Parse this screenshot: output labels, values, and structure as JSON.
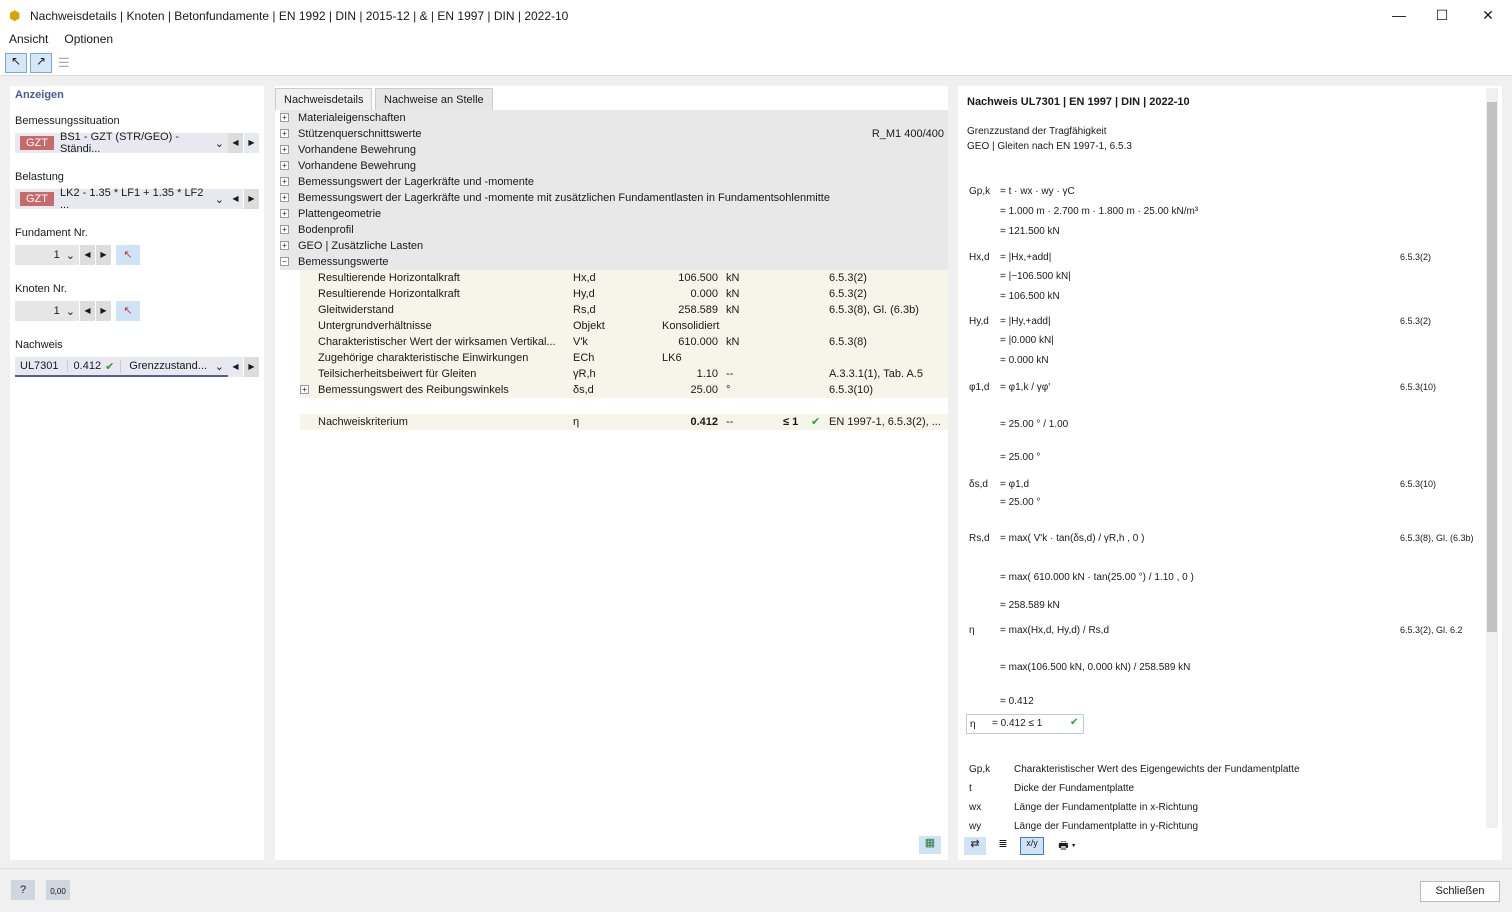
{
  "window": {
    "title": "Nachweisdetails | Knoten | Betonfundamente | EN 1992 | DIN | 2015-12 | & | EN 1997 | DIN | 2022-10"
  },
  "menu": [
    "Ansicht",
    "Optionen"
  ],
  "left": {
    "header": "Anzeigen",
    "design_situation": {
      "label": "Bemessungssituation",
      "badge": "GZT",
      "value": "BS1 - GZT (STR/GEO) - Ständi..."
    },
    "loading": {
      "label": "Belastung",
      "badge": "GZT",
      "value": "LK2 - 1.35 * LF1 + 1.35 * LF2 ..."
    },
    "foundation": {
      "label": "Fundament Nr.",
      "value": "1"
    },
    "node": {
      "label": "Knoten Nr.",
      "value": "1"
    },
    "check": {
      "label": "Nachweis",
      "id": "UL7301",
      "ratio": "0.412",
      "type": "Grenzzustand..."
    }
  },
  "tabs": [
    "Nachweisdetails",
    "Nachweise an Stelle"
  ],
  "tree": [
    {
      "label": "Materialeigenschaften"
    },
    {
      "label": "Stützenquerschnittswerte",
      "value": "R_M1 400/400"
    },
    {
      "label": "Vorhandene Bewehrung"
    },
    {
      "label": "Vorhandene Bewehrung"
    },
    {
      "label": "Bemessungswert der Lagerkräfte und -momente"
    },
    {
      "label": "Bemessungswert der Lagerkräfte und -momente mit zusätzlichen Fundamentlasten in Fundamentsohlenmitte"
    },
    {
      "label": "Plattengeometrie"
    },
    {
      "label": "Bodenprofil"
    },
    {
      "label": "GEO | Zusätzliche Lasten"
    },
    {
      "label": "Bemessungswerte"
    }
  ],
  "rows": [
    {
      "desc": "Resultierende Horizontalkraft",
      "sym": "Hx,d",
      "val": "106.500",
      "unit": "kN",
      "ref": "6.5.3(2)"
    },
    {
      "desc": "Resultierende Horizontalkraft",
      "sym": "Hy,d",
      "val": "0.000",
      "unit": "kN",
      "ref": "6.5.3(2)"
    },
    {
      "desc": "Gleitwiderstand",
      "sym": "Rs,d",
      "val": "258.589",
      "unit": "kN",
      "ref": "6.5.3(8), Gl. (6.3b)"
    },
    {
      "desc": "Untergrundverhältnisse",
      "sym": "Objekt",
      "text": "Konsolidiert"
    },
    {
      "desc": "Charakteristischer Wert der wirksamen Vertikal...",
      "sym": "V'k",
      "val": "610.000",
      "unit": "kN",
      "ref": "6.5.3(8)"
    },
    {
      "desc": "Zugehörige charakteristische Einwirkungen",
      "sym": "ECh",
      "text": "LK6"
    },
    {
      "desc": "Teilsicherheitsbeiwert für Gleiten",
      "sym": "γR,h",
      "val": "1.10",
      "unit": "--",
      "ref": "A.3.3.1(1), Tab. A.5"
    },
    {
      "desc": "Bemessungswert des Reibungswinkels",
      "sym": "δs,d",
      "val": "25.00",
      "unit": "°",
      "ref": "6.5.3(10)"
    }
  ],
  "criterion": {
    "desc": "Nachweiskriterium",
    "sym": "η",
    "val": "0.412",
    "unit": "--",
    "limit": "≤ 1",
    "ref": "EN 1997-1, 6.5.3(2), ..."
  },
  "right": {
    "title": "Nachweis UL7301 | EN 1997 | DIN | 2022-10",
    "sub1": "Grenzzustand der Tragfähigkeit",
    "sub2": "GEO | Gleiten nach EN 1997-1, 6.5.3",
    "formulas": [
      {
        "l": "Gp,k",
        "e": "=  t · wx · wy · γC"
      },
      {
        "e": "=  1.000 m · 2.700 m · 1.800 m · 25.00 kN/m³"
      },
      {
        "e": "=  121.500 kN"
      },
      {
        "l": "Hx,d",
        "e": "=  |Hx,+add|",
        "r": "6.5.3(2)"
      },
      {
        "e": "=  |−106.500 kN|"
      },
      {
        "e": "=  106.500 kN"
      },
      {
        "l": "Hy,d",
        "e": "=  |Hy,+add|",
        "r": "6.5.3(2)"
      },
      {
        "e": "=  |0.000 kN|"
      },
      {
        "e": "=  0.000 kN"
      },
      {
        "l": "φ1,d",
        "e": "=  φ1,k / γφ'",
        "r": "6.5.3(10)"
      },
      {
        "e": "=  25.00 ° / 1.00"
      },
      {
        "e": "=  25.00 °"
      },
      {
        "l": "δs,d",
        "e": "=  φ1,d",
        "r": "6.5.3(10)"
      },
      {
        "e": "=  25.00 °"
      },
      {
        "l": "Rs,d",
        "e": "=  max( V'k · tan(δs,d) / γR,h , 0 )",
        "r": "6.5.3(8), Gl. (6.3b)"
      },
      {
        "e": "=  max( 610.000 kN · tan(25.00 °) / 1.10 , 0 )"
      },
      {
        "e": "=  258.589 kN"
      },
      {
        "l": "η",
        "e": "=  max(Hx,d, Hy,d) / Rs,d",
        "r": "6.5.3(2), Gl. 6.2"
      },
      {
        "e": "=  max(106.500 kN, 0.000 kN) / 258.589 kN"
      },
      {
        "e": "=  0.412"
      }
    ],
    "result": {
      "l": "η",
      "e": "=   0.412  ≤ 1"
    },
    "legend": [
      {
        "s": "Gp,k",
        "d": "Charakteristischer Wert des Eigengewichts der Fundamentplatte"
      },
      {
        "s": "t",
        "d": "Dicke der Fundamentplatte"
      },
      {
        "s": "wx",
        "d": "Länge der Fundamentplatte in x-Richtung"
      },
      {
        "s": "wy",
        "d": "Länge der Fundamentplatte in y-Richtung"
      }
    ]
  },
  "footer": {
    "close": "Schließen",
    "units": "0,00"
  }
}
